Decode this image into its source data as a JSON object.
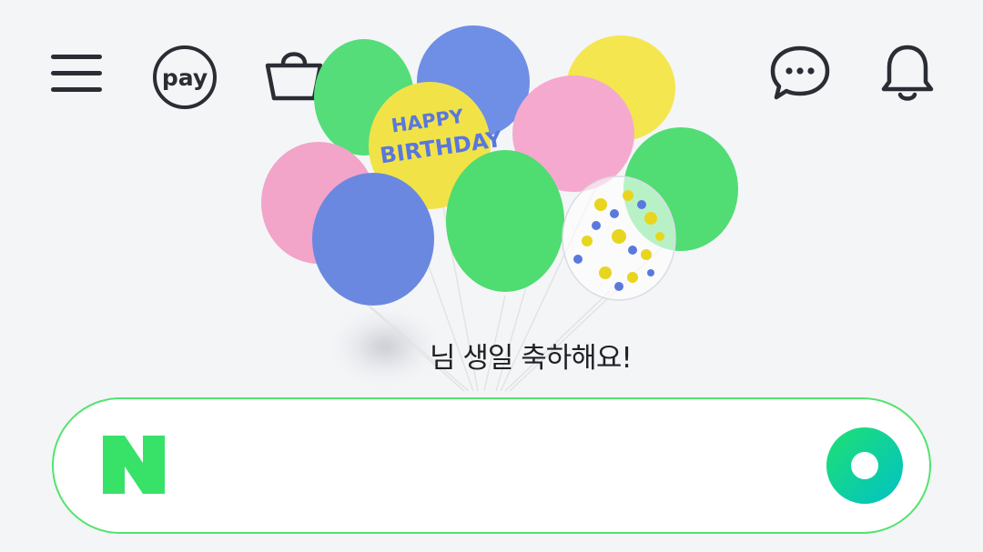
{
  "topbar": {
    "left_icons": [
      "menu-icon",
      "pay-icon",
      "shopping-bag-icon"
    ],
    "pay_label": "pay",
    "right_icons": [
      "chat-icon",
      "bell-icon"
    ]
  },
  "hero": {
    "balloon_text_1": "HAPPY",
    "balloon_text_2": "BIRTHDAY",
    "greeting_text": "님 생일 축하해요!"
  },
  "search": {
    "logo_letter": "N",
    "placeholder": "",
    "accent_color": "#03c75a",
    "border_color": "#53e36f"
  }
}
